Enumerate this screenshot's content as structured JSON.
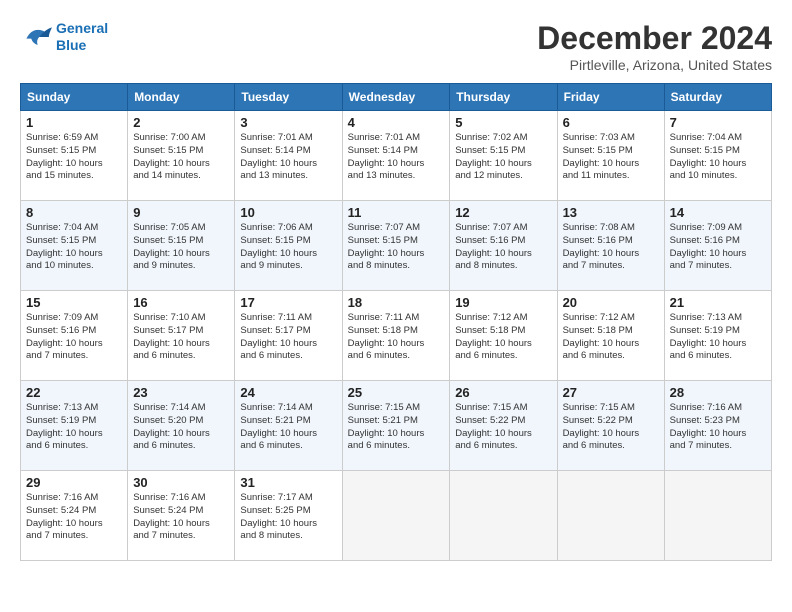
{
  "header": {
    "logo_line1": "General",
    "logo_line2": "Blue",
    "title": "December 2024",
    "location": "Pirtleville, Arizona, United States"
  },
  "weekdays": [
    "Sunday",
    "Monday",
    "Tuesday",
    "Wednesday",
    "Thursday",
    "Friday",
    "Saturday"
  ],
  "weeks": [
    [
      {
        "day": "1",
        "info": "Sunrise: 6:59 AM\nSunset: 5:15 PM\nDaylight: 10 hours\nand 15 minutes."
      },
      {
        "day": "2",
        "info": "Sunrise: 7:00 AM\nSunset: 5:15 PM\nDaylight: 10 hours\nand 14 minutes."
      },
      {
        "day": "3",
        "info": "Sunrise: 7:01 AM\nSunset: 5:14 PM\nDaylight: 10 hours\nand 13 minutes."
      },
      {
        "day": "4",
        "info": "Sunrise: 7:01 AM\nSunset: 5:14 PM\nDaylight: 10 hours\nand 13 minutes."
      },
      {
        "day": "5",
        "info": "Sunrise: 7:02 AM\nSunset: 5:15 PM\nDaylight: 10 hours\nand 12 minutes."
      },
      {
        "day": "6",
        "info": "Sunrise: 7:03 AM\nSunset: 5:15 PM\nDaylight: 10 hours\nand 11 minutes."
      },
      {
        "day": "7",
        "info": "Sunrise: 7:04 AM\nSunset: 5:15 PM\nDaylight: 10 hours\nand 10 minutes."
      }
    ],
    [
      {
        "day": "8",
        "info": "Sunrise: 7:04 AM\nSunset: 5:15 PM\nDaylight: 10 hours\nand 10 minutes."
      },
      {
        "day": "9",
        "info": "Sunrise: 7:05 AM\nSunset: 5:15 PM\nDaylight: 10 hours\nand 9 minutes."
      },
      {
        "day": "10",
        "info": "Sunrise: 7:06 AM\nSunset: 5:15 PM\nDaylight: 10 hours\nand 9 minutes."
      },
      {
        "day": "11",
        "info": "Sunrise: 7:07 AM\nSunset: 5:15 PM\nDaylight: 10 hours\nand 8 minutes."
      },
      {
        "day": "12",
        "info": "Sunrise: 7:07 AM\nSunset: 5:16 PM\nDaylight: 10 hours\nand 8 minutes."
      },
      {
        "day": "13",
        "info": "Sunrise: 7:08 AM\nSunset: 5:16 PM\nDaylight: 10 hours\nand 7 minutes."
      },
      {
        "day": "14",
        "info": "Sunrise: 7:09 AM\nSunset: 5:16 PM\nDaylight: 10 hours\nand 7 minutes."
      }
    ],
    [
      {
        "day": "15",
        "info": "Sunrise: 7:09 AM\nSunset: 5:16 PM\nDaylight: 10 hours\nand 7 minutes."
      },
      {
        "day": "16",
        "info": "Sunrise: 7:10 AM\nSunset: 5:17 PM\nDaylight: 10 hours\nand 6 minutes."
      },
      {
        "day": "17",
        "info": "Sunrise: 7:11 AM\nSunset: 5:17 PM\nDaylight: 10 hours\nand 6 minutes."
      },
      {
        "day": "18",
        "info": "Sunrise: 7:11 AM\nSunset: 5:18 PM\nDaylight: 10 hours\nand 6 minutes."
      },
      {
        "day": "19",
        "info": "Sunrise: 7:12 AM\nSunset: 5:18 PM\nDaylight: 10 hours\nand 6 minutes."
      },
      {
        "day": "20",
        "info": "Sunrise: 7:12 AM\nSunset: 5:18 PM\nDaylight: 10 hours\nand 6 minutes."
      },
      {
        "day": "21",
        "info": "Sunrise: 7:13 AM\nSunset: 5:19 PM\nDaylight: 10 hours\nand 6 minutes."
      }
    ],
    [
      {
        "day": "22",
        "info": "Sunrise: 7:13 AM\nSunset: 5:19 PM\nDaylight: 10 hours\nand 6 minutes."
      },
      {
        "day": "23",
        "info": "Sunrise: 7:14 AM\nSunset: 5:20 PM\nDaylight: 10 hours\nand 6 minutes."
      },
      {
        "day": "24",
        "info": "Sunrise: 7:14 AM\nSunset: 5:21 PM\nDaylight: 10 hours\nand 6 minutes."
      },
      {
        "day": "25",
        "info": "Sunrise: 7:15 AM\nSunset: 5:21 PM\nDaylight: 10 hours\nand 6 minutes."
      },
      {
        "day": "26",
        "info": "Sunrise: 7:15 AM\nSunset: 5:22 PM\nDaylight: 10 hours\nand 6 minutes."
      },
      {
        "day": "27",
        "info": "Sunrise: 7:15 AM\nSunset: 5:22 PM\nDaylight: 10 hours\nand 6 minutes."
      },
      {
        "day": "28",
        "info": "Sunrise: 7:16 AM\nSunset: 5:23 PM\nDaylight: 10 hours\nand 7 minutes."
      }
    ],
    [
      {
        "day": "29",
        "info": "Sunrise: 7:16 AM\nSunset: 5:24 PM\nDaylight: 10 hours\nand 7 minutes."
      },
      {
        "day": "30",
        "info": "Sunrise: 7:16 AM\nSunset: 5:24 PM\nDaylight: 10 hours\nand 7 minutes."
      },
      {
        "day": "31",
        "info": "Sunrise: 7:17 AM\nSunset: 5:25 PM\nDaylight: 10 hours\nand 8 minutes."
      },
      {
        "day": "",
        "info": ""
      },
      {
        "day": "",
        "info": ""
      },
      {
        "day": "",
        "info": ""
      },
      {
        "day": "",
        "info": ""
      }
    ]
  ]
}
